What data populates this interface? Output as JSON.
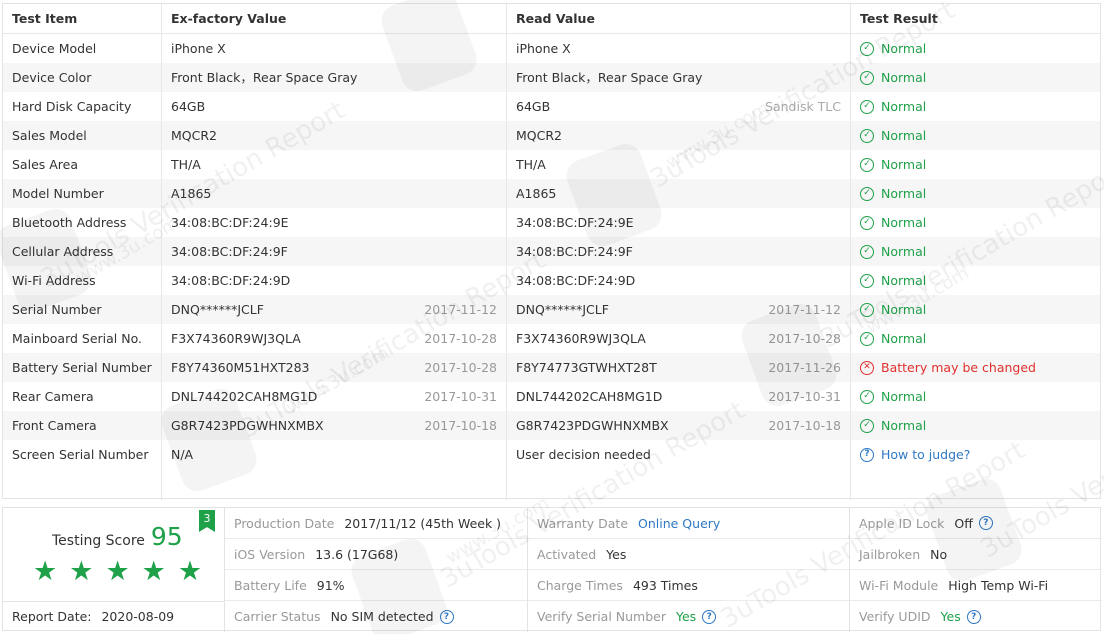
{
  "table": {
    "headers": [
      "Test Item",
      "Ex-factory Value",
      "Read Value",
      "Test Result"
    ],
    "rows": [
      {
        "item": "Device Model",
        "factory": "iPhone X",
        "factory_date": "",
        "read": "iPhone X",
        "read_date": "",
        "read_note": "",
        "result": "Normal",
        "status": "ok"
      },
      {
        "item": "Device Color",
        "factory": "Front Black，Rear Space Gray",
        "factory_date": "",
        "read": "Front Black，Rear Space Gray",
        "read_date": "",
        "read_note": "",
        "result": "Normal",
        "status": "ok"
      },
      {
        "item": "Hard Disk Capacity",
        "factory": "64GB",
        "factory_date": "",
        "read": "64GB",
        "read_date": "",
        "read_note": "Sandisk TLC",
        "result": "Normal",
        "status": "ok"
      },
      {
        "item": "Sales Model",
        "factory": "MQCR2",
        "factory_date": "",
        "read": "MQCR2",
        "read_date": "",
        "read_note": "",
        "result": "Normal",
        "status": "ok"
      },
      {
        "item": "Sales Area",
        "factory": "TH/A",
        "factory_date": "",
        "read": "TH/A",
        "read_date": "",
        "read_note": "",
        "result": "Normal",
        "status": "ok"
      },
      {
        "item": "Model Number",
        "factory": "A1865",
        "factory_date": "",
        "read": "A1865",
        "read_date": "",
        "read_note": "",
        "result": "Normal",
        "status": "ok"
      },
      {
        "item": "Bluetooth Address",
        "factory": "34:08:BC:DF:24:9E",
        "factory_date": "",
        "read": "34:08:BC:DF:24:9E",
        "read_date": "",
        "read_note": "",
        "result": "Normal",
        "status": "ok"
      },
      {
        "item": "Cellular Address",
        "factory": "34:08:BC:DF:24:9F",
        "factory_date": "",
        "read": "34:08:BC:DF:24:9F",
        "read_date": "",
        "read_note": "",
        "result": "Normal",
        "status": "ok"
      },
      {
        "item": "Wi-Fi Address",
        "factory": "34:08:BC:DF:24:9D",
        "factory_date": "",
        "read": "34:08:BC:DF:24:9D",
        "read_date": "",
        "read_note": "",
        "result": "Normal",
        "status": "ok"
      },
      {
        "item": "Serial Number",
        "factory": "DNQ******JCLF",
        "factory_date": "2017-11-12",
        "read": "DNQ******JCLF",
        "read_date": "2017-11-12",
        "read_note": "",
        "result": "Normal",
        "status": "ok"
      },
      {
        "item": "Mainboard Serial No.",
        "factory": "F3X74360R9WJ3QLA",
        "factory_date": "2017-10-28",
        "read": "F3X74360R9WJ3QLA",
        "read_date": "2017-10-28",
        "read_note": "",
        "result": "Normal",
        "status": "ok"
      },
      {
        "item": "Battery Serial Number",
        "factory": "F8Y74360M51HXT283",
        "factory_date": "2017-10-28",
        "read": "F8Y74773GTWHXT28T",
        "read_date": "2017-11-26",
        "read_note": "",
        "result": "Battery may be changed",
        "status": "bad"
      },
      {
        "item": "Rear Camera",
        "factory": "DNL744202CAH8MG1D",
        "factory_date": "2017-10-31",
        "read": "DNL744202CAH8MG1D",
        "read_date": "2017-10-31",
        "read_note": "",
        "result": "Normal",
        "status": "ok"
      },
      {
        "item": "Front Camera",
        "factory": "G8R7423PDGWHNXMBX",
        "factory_date": "2017-10-18",
        "read": "G8R7423PDGWHNXMBX",
        "read_date": "2017-10-18",
        "read_note": "",
        "result": "Normal",
        "status": "ok"
      },
      {
        "item": "Screen Serial Number",
        "factory": "N/A",
        "factory_date": "",
        "read": "User decision needed",
        "read_date": "",
        "read_note": "",
        "result": "How to judge?",
        "status": "info"
      }
    ]
  },
  "score": {
    "label": "Testing Score",
    "value": "95",
    "badge": "3",
    "stars": 5,
    "report_date_label": "Report Date:",
    "report_date": "2020-08-09"
  },
  "info": {
    "col1": [
      {
        "k": "Production Date",
        "v": "2017/11/12 (45th Week )",
        "style": "",
        "help": false
      },
      {
        "k": "iOS Version",
        "v": "13.6 (17G68)",
        "style": "",
        "help": false
      },
      {
        "k": "Battery Life",
        "v": "91%",
        "style": "",
        "help": false
      },
      {
        "k": "Carrier Status",
        "v": "No SIM detected",
        "style": "",
        "help": true
      }
    ],
    "col2": [
      {
        "k": "Warranty Date",
        "v": "Online Query",
        "style": "link",
        "help": false
      },
      {
        "k": "Activated",
        "v": "Yes",
        "style": "",
        "help": false
      },
      {
        "k": "Charge Times",
        "v": "493 Times",
        "style": "",
        "help": false
      },
      {
        "k": "Verify Serial Number",
        "v": "Yes",
        "style": "green",
        "help": true
      }
    ],
    "col3": [
      {
        "k": "Apple ID Lock",
        "v": "Off",
        "style": "",
        "help": true
      },
      {
        "k": "Jailbroken",
        "v": "No",
        "style": "",
        "help": false
      },
      {
        "k": "Wi-Fi Module",
        "v": "High Temp Wi-Fi",
        "style": "",
        "help": false
      },
      {
        "k": "Verify UDID",
        "v": "Yes",
        "style": "green",
        "help": true
      }
    ]
  },
  "watermark": {
    "text": "3uTools Verification Report",
    "url": "www.3u.com"
  },
  "colors": {
    "normal": "#1fa14a",
    "warning": "#e0302c",
    "link": "#2f78c4"
  }
}
